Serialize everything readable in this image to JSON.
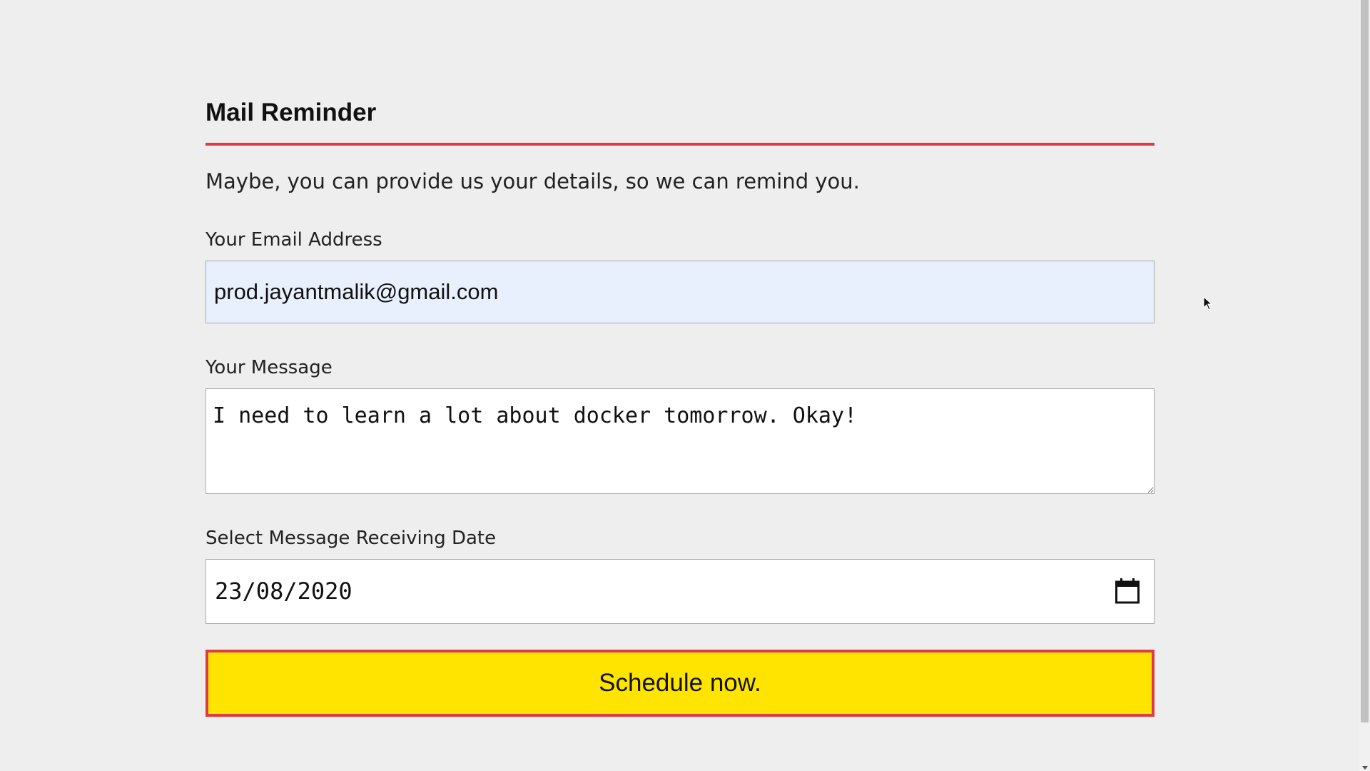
{
  "form": {
    "title": "Mail Reminder",
    "intro": "Maybe, you can provide us your details, so we can remind you.",
    "email_label": "Your Email Address",
    "email_value": "prod.jayantmalik@gmail.com",
    "message_label": "Your Message",
    "message_value": "I need to learn a lot about docker tomorrow. Okay!",
    "date_label": "Select Message Receiving Date",
    "date_value": "23/08/2020",
    "submit_label": "Schedule now."
  },
  "colors": {
    "accent_red": "#dc3c46",
    "button_yellow": "#ffe400",
    "autofill_blue": "#e8f0fe",
    "page_background": "#eeeeee"
  },
  "icons": {
    "date_picker": "calendar-icon",
    "pointer": "mouse-cursor-icon"
  }
}
